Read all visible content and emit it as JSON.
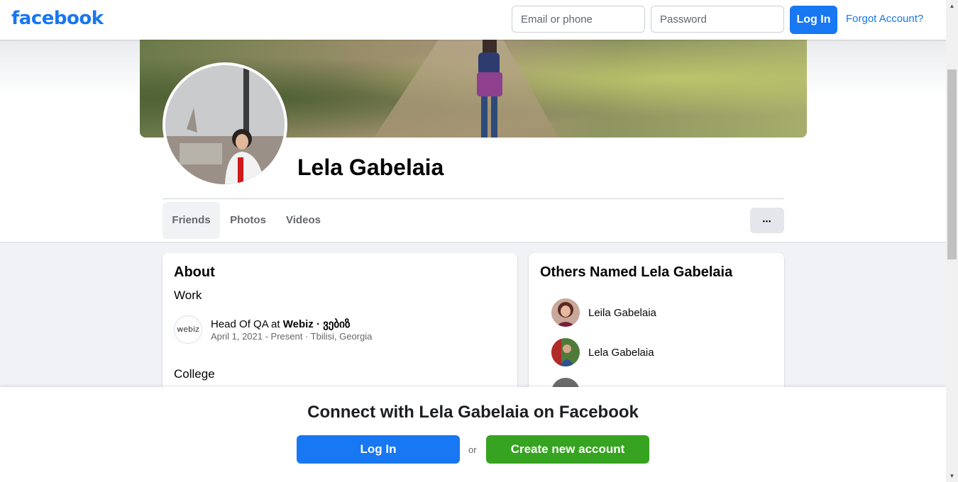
{
  "nav": {
    "logo": "facebook",
    "email_placeholder": "Email or phone",
    "password_placeholder": "Password",
    "login_label": "Log In",
    "forgot_label": "Forgot Account?"
  },
  "profile": {
    "name": "Lela Gabelaia",
    "tabs": [
      "Friends",
      "Photos",
      "Videos"
    ],
    "active_tab": "Friends",
    "more_label": "•••"
  },
  "about": {
    "title": "About",
    "work_heading": "Work",
    "work_logo": "webiz",
    "work_role_prefix": "Head Of QA at ",
    "work_company": "Webiz · ვებიზ",
    "work_detail": "April 1, 2021 - Present · Tbilisi, Georgia",
    "college_heading": "College"
  },
  "others": {
    "title": "Others Named Lela Gabelaia",
    "people": [
      {
        "name": "Leila Gabelaia"
      },
      {
        "name": "Lela Gabelaia"
      }
    ]
  },
  "banner": {
    "title": "Connect with Lela Gabelaia on Facebook",
    "login_label": "Log In",
    "or_label": "or",
    "create_label": "Create new account"
  },
  "colors": {
    "brand_blue": "#1877f2",
    "create_green": "#36a420",
    "page_bg": "#f0f2f5"
  },
  "icons": {
    "more": "more-horizontal-icon",
    "scroll_up": "scroll-up-arrow-icon",
    "scroll_down": "scroll-down-arrow-icon"
  }
}
